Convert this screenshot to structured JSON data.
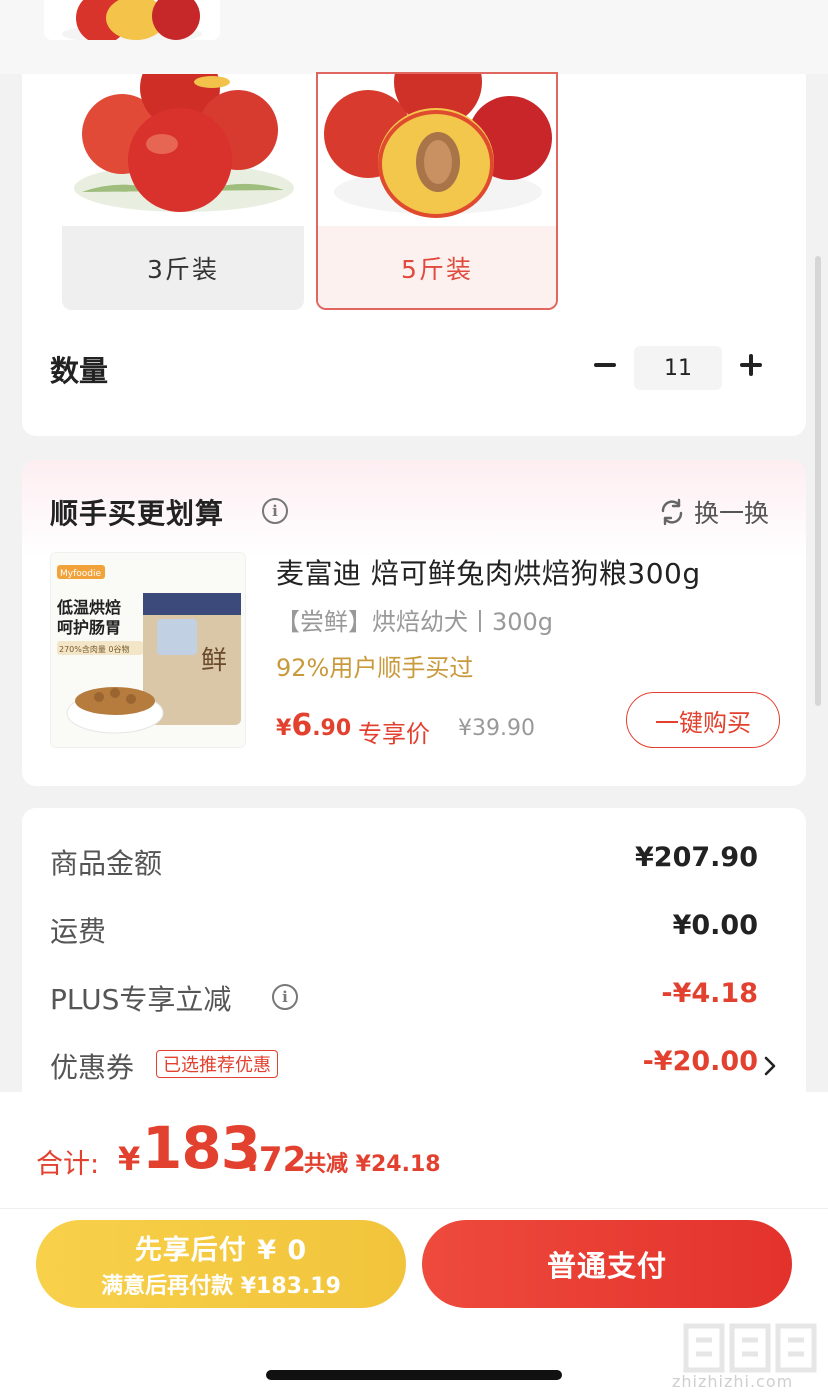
{
  "spec": {
    "options": [
      {
        "label": "3斤装",
        "selected": false
      },
      {
        "label": "5斤装",
        "selected": true
      }
    ]
  },
  "quantity": {
    "label": "数量",
    "value": "11"
  },
  "addon": {
    "title": "顺手买更划算",
    "swap_label": "换一换",
    "product_name": "麦富迪 焙可鲜兔肉烘焙狗粮300g",
    "product_spec": "【尝鲜】烘焙幼犬丨300g",
    "product_stat": "92%用户顺手买过",
    "price_yen": "¥",
    "price_int": "6",
    "price_dec": ".90",
    "price_tag": "专享价",
    "original_price": "¥39.90",
    "buy_label": "一键购买",
    "image_texts": {
      "line1": "低温烘焙",
      "line2": "呵护肠胃",
      "badge": "270%含肉量  0谷物",
      "brand": "Myfoodie",
      "char": "鲜"
    }
  },
  "summary": {
    "rows": [
      {
        "label": "商品金额",
        "value": "¥207.90"
      },
      {
        "label": "运费",
        "value": "¥0.00"
      },
      {
        "label": "PLUS专享立减",
        "value": "-¥4.18"
      },
      {
        "label": "优惠券",
        "tag": "已选推荐优惠",
        "value": "-¥20.00"
      }
    ]
  },
  "total": {
    "label": "合计:",
    "yen": "¥",
    "int": "183",
    "dec": ".72",
    "save": "共减 ¥24.18"
  },
  "buttons": {
    "pay_later_line1": "先享后付 ¥ 0",
    "pay_later_line2": "满意后再付款 ¥183.19",
    "pay": "普通支付"
  },
  "watermark": {
    "text": "zhizhizhi.com"
  },
  "colors": {
    "accent_red": "#e3412f",
    "gold": "#f1c43b",
    "gold_text": "#c99a3c"
  }
}
